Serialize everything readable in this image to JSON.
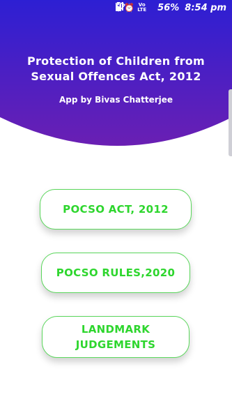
{
  "status_bar": {
    "icons": [
      "location-icon",
      "alarm-icon",
      "volte-icon",
      "wifi-icon",
      "signal-icon",
      "signal-icon"
    ],
    "volte_label_top": "Vo",
    "volte_label_bottom": "LTE",
    "battery_percent": "56%",
    "time": "8:54 pm"
  },
  "header": {
    "title": "Protection of Children from Sexual Offences Act, 2012",
    "subtitle": "App by Bivas Chatterjee",
    "gradient_top": "#2d1fd3",
    "gradient_bottom": "#6a1fb3"
  },
  "menu": {
    "accent": "#2ed62e",
    "items": [
      {
        "label": "POCSO ACT, 2012"
      },
      {
        "label": "POCSO RULES,2020"
      },
      {
        "label": "LANDMARK JUDGEMENTS"
      }
    ]
  }
}
